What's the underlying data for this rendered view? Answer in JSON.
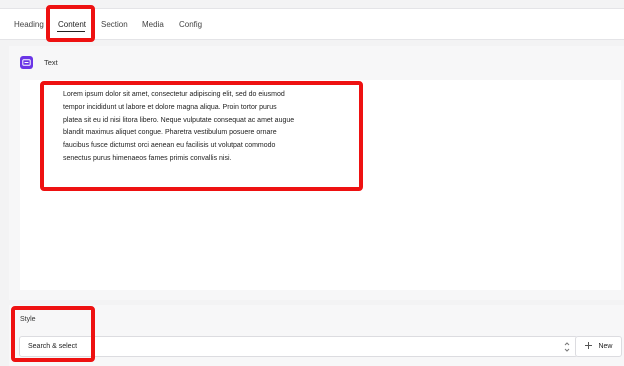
{
  "tabs": [
    {
      "label": "Heading"
    },
    {
      "label": "Content"
    },
    {
      "label": "Section"
    },
    {
      "label": "Media"
    },
    {
      "label": "Config"
    }
  ],
  "active_tab": "Content",
  "content": {
    "field_icon": "text-block-icon",
    "field_label": "Text",
    "body_lines": [
      "Lorem ipsum dolor sit amet, consectetur adipiscing elit, sed do eiusmod",
      "tempor incididunt ut labore et dolore magna aliqua. Proin tortor purus",
      "platea sit eu id nisi litora libero. Neque vulputate consequat ac amet augue",
      "blandit maximus aliquet congue. Pharetra vestibulum posuere ornare",
      "faucibus fusce dictumst orci aenean eu facilisis ut volutpat commodo",
      "senectus purus himenaeos fames primis convallis nisi."
    ]
  },
  "style": {
    "label": "Style",
    "select_value": "Search & select",
    "select_icon": "chevron-updown-icon",
    "new_button_label": "New",
    "new_button_icon": "plus-icon"
  },
  "colors": {
    "accent": "#6a35e6",
    "highlight": "#ee1111"
  }
}
